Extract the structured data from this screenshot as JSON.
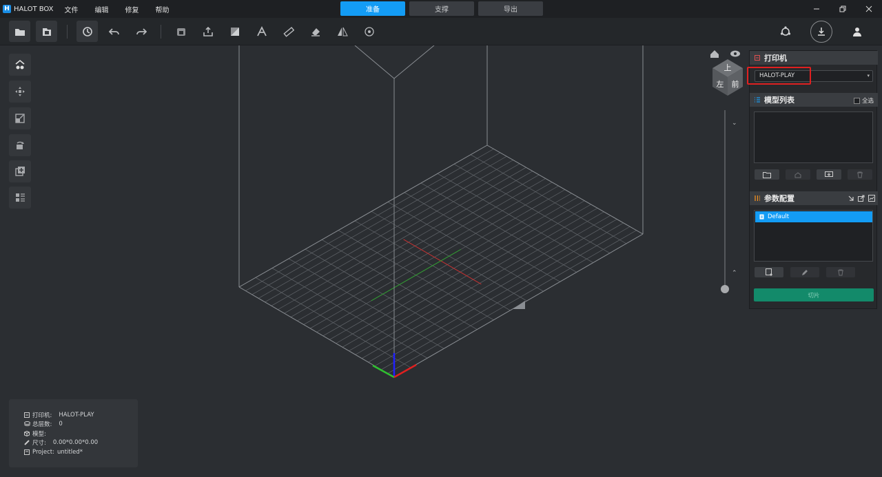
{
  "titlebar": {
    "app_name": "HALOT BOX",
    "logo_letter": "H",
    "menu": [
      "文件",
      "编辑",
      "修复",
      "帮助"
    ],
    "mode_tabs": [
      {
        "label": "准备",
        "active": true
      },
      {
        "label": "支撑",
        "active": false
      },
      {
        "label": "导出",
        "active": false
      }
    ],
    "window_controls": [
      "minimize-icon",
      "restore-icon",
      "close-icon"
    ]
  },
  "toolbar": {
    "left_buttons": [
      "open-folder-icon",
      "open-project-icon"
    ],
    "history_buttons": [
      "history-icon",
      "undo-icon",
      "redo-icon"
    ],
    "tool_buttons": [
      "hollow-icon",
      "export-icon",
      "slice-plane-icon",
      "text-icon",
      "ruler-icon",
      "eraser-icon",
      "mirror-icon",
      "lattice-icon"
    ],
    "right_buttons": [
      "connect-icon",
      "download-icon",
      "user-icon"
    ]
  },
  "left_tools": [
    "view-icon",
    "move-icon",
    "scale-icon",
    "rotate-icon",
    "add-model-icon",
    "list-icon"
  ],
  "view_cube": {
    "faces": [
      "上",
      "左",
      "前"
    ],
    "home_icon": "home-icon",
    "eye_icon": "eye-icon"
  },
  "info": {
    "printer_label": "打印机:",
    "printer_value": "HALOT-PLAY",
    "layers_label": "总层数:",
    "layers_value": "0",
    "model_label": "模型:",
    "model_value": "",
    "size_label": "尺寸:",
    "size_value": "0.00*0.00*0.00",
    "project_label": "Project:",
    "project_value": "untitled*"
  },
  "panel": {
    "printer": {
      "title": "打印机",
      "selected": "HALOT-PLAY"
    },
    "model_list": {
      "title": "模型列表",
      "select_all": "全选",
      "buttons": [
        "folder-icon",
        "duplicate-icon",
        "import-icon",
        "trash-icon"
      ]
    },
    "params": {
      "title": "参数配置",
      "header_icons": [
        "import-config-icon",
        "export-config-icon",
        "chart-icon"
      ],
      "profiles": [
        "Default"
      ],
      "buttons": [
        "new-profile-icon",
        "edit-icon",
        "trash-icon"
      ]
    },
    "slice_button": "切片"
  },
  "colors": {
    "accent": "#139cf5",
    "slice": "#138a6a",
    "highlight": "#e02020",
    "axis_x": "#e02020",
    "axis_y": "#30c030",
    "axis_z": "#2020ff"
  }
}
